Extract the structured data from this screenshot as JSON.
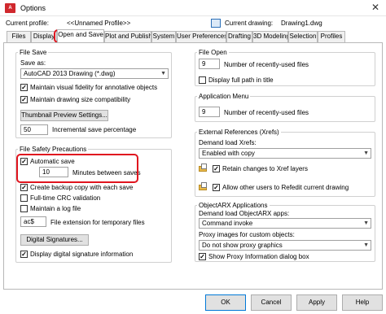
{
  "window": {
    "title": "Options",
    "app_icon_text": "A"
  },
  "profile": {
    "current_profile_label": "Current profile:",
    "current_profile_value": "<<Unnamed Profile>>",
    "current_drawing_label": "Current drawing:",
    "current_drawing_value": "Drawing1.dwg"
  },
  "tabs": [
    "Files",
    "Display",
    "Open and Save",
    "Plot and Publish",
    "System",
    "User Preferences",
    "Drafting",
    "3D Modeling",
    "Selection",
    "Profiles"
  ],
  "file_save": {
    "title": "File Save",
    "save_as_label": "Save as:",
    "save_as_value": "AutoCAD 2013 Drawing (*.dwg)",
    "maintain_visual_fidelity": "Maintain visual fidelity for annotative objects",
    "maintain_drawing_size": "Maintain drawing size compatibility",
    "thumbnail_button": "Thumbnail Preview Settings...",
    "incremental_value": "50",
    "incremental_label": "Incremental save percentage"
  },
  "file_safety": {
    "title": "File Safety Precautions",
    "automatic_save": "Automatic save",
    "minutes_value": "10",
    "minutes_label": "Minutes between saves",
    "create_backup": "Create backup copy with each save",
    "full_time_crc": "Full-time CRC validation",
    "maintain_log": "Maintain a log file",
    "extension_value": "ac$",
    "extension_label": "File extension for temporary files",
    "digital_signatures_button": "Digital Signatures...",
    "display_digital_signature": "Display digital signature information"
  },
  "file_open": {
    "title": "File Open",
    "recent_value": "9",
    "recent_label": "Number of recently-used files",
    "display_full_path": "Display full path in title"
  },
  "application_menu": {
    "title": "Application Menu",
    "recent_value": "9",
    "recent_label": "Number of recently-used files"
  },
  "xrefs": {
    "title": "External References (Xrefs)",
    "demand_load_label": "Demand load Xrefs:",
    "demand_load_value": "Enabled with copy",
    "retain_changes": "Retain changes to Xref layers",
    "allow_other_users": "Allow other users to Refedit current drawing"
  },
  "objectarx": {
    "title": "ObjectARX Applications",
    "demand_load_label": "Demand load ObjectARX apps:",
    "demand_load_value": "Command invoke",
    "proxy_images_label": "Proxy images for custom objects:",
    "proxy_images_value": "Do not show proxy graphics",
    "show_proxy_dialog": "Show Proxy Information dialog box"
  },
  "buttons": {
    "ok": "OK",
    "cancel": "Cancel",
    "apply": "Apply",
    "help": "Help"
  },
  "colors": {
    "highlight": "#e0141e",
    "app_icon": "#d0282d"
  }
}
